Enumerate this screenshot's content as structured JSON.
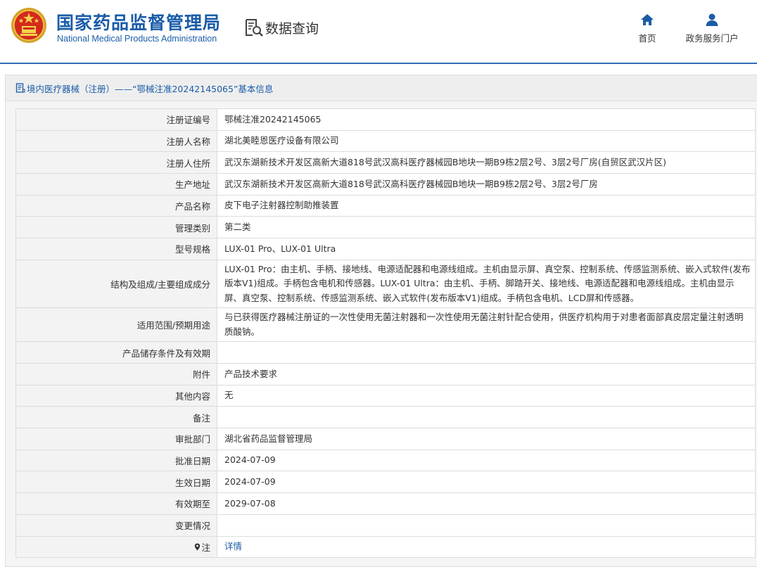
{
  "header": {
    "org_name_cn": "国家药品监督管理局",
    "org_name_en": "National Medical Products Administration",
    "section_label": "数据查询",
    "nav": [
      {
        "label": "首页",
        "icon": "home-icon"
      },
      {
        "label": "政务服务门户",
        "icon": "user-icon"
      }
    ],
    "accent_color": "#1a5ca8"
  },
  "breadcrumb": {
    "text": "境内医疗器械（注册）——“鄂械注准20242145065”基本信息",
    "icon": "document-icon"
  },
  "record": {
    "rows": [
      {
        "label": "注册证编号",
        "value": "鄂械注准20242145065"
      },
      {
        "label": "注册人名称",
        "value": "湖北美睦恩医疗设备有限公司"
      },
      {
        "label": "注册人住所",
        "value": "武汉东湖新技术开发区高新大道818号武汉高科医疗器械园B地块一期B9栋2层2号、3层2号厂房(自贸区武汉片区)"
      },
      {
        "label": "生产地址",
        "value": "武汉东湖新技术开发区高新大道818号武汉高科医疗器械园B地块一期B9栋2层2号、3层2号厂房"
      },
      {
        "label": "产品名称",
        "value": "皮下电子注射器控制助推装置"
      },
      {
        "label": "管理类别",
        "value": "第二类"
      },
      {
        "label": "型号规格",
        "value": "LUX-01 Pro、LUX-01 Ultra"
      },
      {
        "label": "结构及组成/主要组成成分",
        "value": "LUX-01 Pro：由主机、手柄、接地线、电源适配器和电源线组成。主机由显示屏、真空泵、控制系统、传感监测系统、嵌入式软件(发布版本V1)组成。手柄包含电机和传感器。LUX-01 Ultra：由主机、手柄、脚踏开关、接地线、电源适配器和电源线组成。主机由显示屏、真空泵、控制系统、传感监测系统、嵌入式软件(发布版本V1)组成。手柄包含电机、LCD屏和传感器。"
      },
      {
        "label": "适用范围/预期用途",
        "value": "与已获得医疗器械注册证的一次性使用无菌注射器和一次性使用无菌注射针配合使用，供医疗机构用于对患者面部真皮层定量注射透明质酸钠。"
      },
      {
        "label": "产品储存条件及有效期",
        "value": ""
      },
      {
        "label": "附件",
        "value": "产品技术要求"
      },
      {
        "label": "其他内容",
        "value": "无"
      },
      {
        "label": "备注",
        "value": ""
      },
      {
        "label": "审批部门",
        "value": "湖北省药品监督管理局"
      },
      {
        "label": "批准日期",
        "value": "2024-07-09"
      },
      {
        "label": "生效日期",
        "value": "2024-07-09"
      },
      {
        "label": "有效期至",
        "value": "2029-07-08"
      },
      {
        "label": "变更情况",
        "value": ""
      }
    ],
    "note_row": {
      "label": "注",
      "icon": "location-pin-icon",
      "link_text": "详情"
    }
  }
}
